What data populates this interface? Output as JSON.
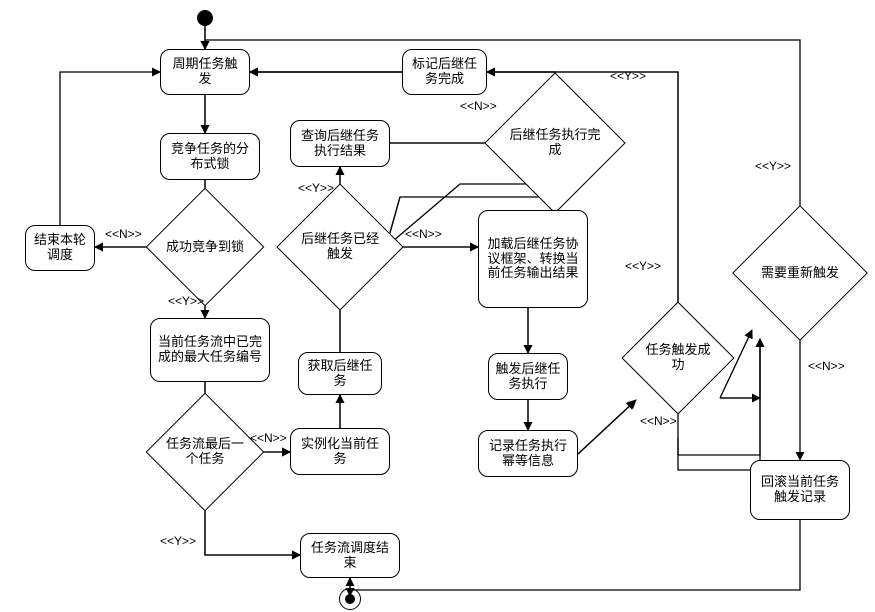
{
  "chart_data": {
    "type": "flowchart",
    "title": "",
    "nodes": [
      {
        "id": "start",
        "type": "initial",
        "label": ""
      },
      {
        "id": "n1",
        "type": "process",
        "label": "周期任务触发"
      },
      {
        "id": "n2",
        "type": "process",
        "label": "竞争任务的分布式锁"
      },
      {
        "id": "d1",
        "type": "decision",
        "label": "成功竞争到锁"
      },
      {
        "id": "end_sched",
        "type": "process",
        "label": "结束本轮调度"
      },
      {
        "id": "n3",
        "type": "process",
        "label": "当前任务流中已完成的最大任务编号"
      },
      {
        "id": "d2",
        "type": "decision",
        "label": "任务流最后一个任务"
      },
      {
        "id": "n4",
        "type": "process",
        "label": "实例化当前任务"
      },
      {
        "id": "n5",
        "type": "process",
        "label": "获取后继任务"
      },
      {
        "id": "d3",
        "type": "decision",
        "label": "后继任务已经触发"
      },
      {
        "id": "n6",
        "type": "process",
        "label": "查询后继任务执行结果"
      },
      {
        "id": "d4",
        "type": "decision",
        "label": "后继任务执行完成"
      },
      {
        "id": "n7",
        "type": "process",
        "label": "标记后继任务完成"
      },
      {
        "id": "n8",
        "type": "process",
        "label": "加载后继任务协议框架、转换当前任务输出结果"
      },
      {
        "id": "n9",
        "type": "process",
        "label": "触发后继任务执行"
      },
      {
        "id": "n10",
        "type": "process",
        "label": "记录任务执行幂等信息"
      },
      {
        "id": "d5",
        "type": "decision",
        "label": "任务触发成功"
      },
      {
        "id": "d6",
        "type": "decision",
        "label": "需要重新触发"
      },
      {
        "id": "n11",
        "type": "process",
        "label": "回滚当前任务触发记录"
      },
      {
        "id": "flow_end",
        "type": "process",
        "label": "任务流调度结束"
      },
      {
        "id": "final",
        "type": "final",
        "label": ""
      }
    ],
    "edges": [
      {
        "from": "start",
        "to": "n1",
        "label": ""
      },
      {
        "from": "n1",
        "to": "n2",
        "label": ""
      },
      {
        "from": "n2",
        "to": "d1",
        "label": ""
      },
      {
        "from": "d1",
        "to": "end_sched",
        "label": "<<N>>"
      },
      {
        "from": "d1",
        "to": "n3",
        "label": "<<Y>>"
      },
      {
        "from": "n3",
        "to": "d2",
        "label": ""
      },
      {
        "from": "d2",
        "to": "n4",
        "label": "<<N>>"
      },
      {
        "from": "d2",
        "to": "flow_end",
        "label": "<<Y>>"
      },
      {
        "from": "n4",
        "to": "n5",
        "label": ""
      },
      {
        "from": "n5",
        "to": "d3",
        "label": ""
      },
      {
        "from": "d3",
        "to": "n6",
        "label": "<<Y>>"
      },
      {
        "from": "d3",
        "to": "n8",
        "label": "<<N>>"
      },
      {
        "from": "n6",
        "to": "d4",
        "label": ""
      },
      {
        "from": "d4",
        "to": "n7",
        "label": "<<Y>>"
      },
      {
        "from": "d4",
        "to": "d3",
        "label": "<<N>>"
      },
      {
        "from": "n7",
        "to": "n1",
        "label": ""
      },
      {
        "from": "n8",
        "to": "n9",
        "label": ""
      },
      {
        "from": "n9",
        "to": "n10",
        "label": ""
      },
      {
        "from": "n10",
        "to": "d5",
        "label": ""
      },
      {
        "from": "d5",
        "to": "n1",
        "label": "<<Y>>"
      },
      {
        "from": "d5",
        "to": "d6",
        "label": "<<N>>"
      },
      {
        "from": "d6",
        "to": "n1",
        "label": "<<Y>>"
      },
      {
        "from": "d6",
        "to": "n11",
        "label": "<<N>>"
      },
      {
        "from": "n11",
        "to": "flow_end",
        "label": ""
      },
      {
        "from": "end_sched",
        "to": "n1",
        "label": ""
      },
      {
        "from": "flow_end",
        "to": "final",
        "label": ""
      }
    ]
  },
  "labels": {
    "y": "<<Y>>",
    "n": "<<N>>"
  }
}
